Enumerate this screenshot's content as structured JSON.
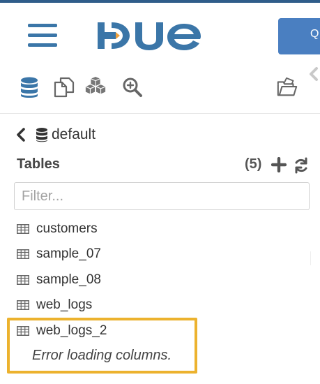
{
  "header": {
    "logo_text": "HUE",
    "query_button_label": "Q"
  },
  "toolbar": {
    "icons": [
      "database-icon",
      "documents-icon",
      "stacked-boxes-icon",
      "search-zoom-icon",
      "open-folder-icon"
    ]
  },
  "assist": {
    "database_name": "default",
    "tables_label": "Tables",
    "tables_count": "(5)",
    "filter_placeholder": "Filter...",
    "tables": [
      {
        "name": "customers"
      },
      {
        "name": "sample_07"
      },
      {
        "name": "sample_08"
      },
      {
        "name": "web_logs"
      },
      {
        "name": "web_logs_2"
      }
    ],
    "error_message": "Error loading columns."
  },
  "colors": {
    "brand_blue": "#3b76a8",
    "button_blue": "#4a7fc1",
    "highlight": "#ecb22e"
  }
}
